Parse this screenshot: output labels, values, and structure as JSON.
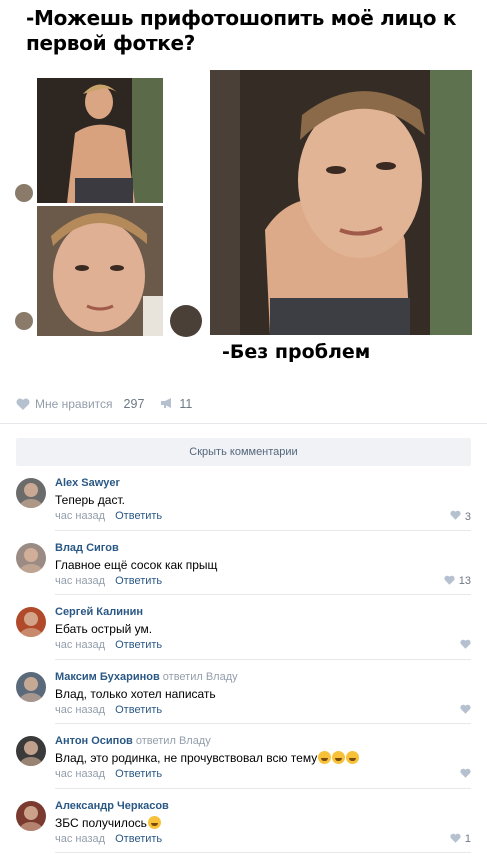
{
  "meme": {
    "caption": "-Можешь прифотошопить моё лицо к первой фотке?",
    "reply": "-Без проблем"
  },
  "post_stats": {
    "like_label": "Мне нравится",
    "like_count": "297",
    "share_count": "11"
  },
  "hide_comments_label": "Скрыть комментарии",
  "comments": [
    {
      "author": "Alex Sawyer",
      "reply_word": "",
      "reply_target": "",
      "text": "Теперь даст.",
      "time": "час назад",
      "reply_label": "Ответить",
      "likes": "3",
      "emojis": 0,
      "avatar_color": "#6b6b6b"
    },
    {
      "author": "Влад Сигов",
      "reply_word": "",
      "reply_target": "",
      "text": "Главное ещё сосок как прыщ",
      "time": "час назад",
      "reply_label": "Ответить",
      "likes": "13",
      "emojis": 0,
      "avatar_color": "#9a8c84"
    },
    {
      "author": "Сергей Калинин",
      "reply_word": "",
      "reply_target": "",
      "text": "Ебать острый ум.",
      "time": "час назад",
      "reply_label": "Ответить",
      "likes": "",
      "emojis": 0,
      "avatar_color": "#b04a2a"
    },
    {
      "author": "Максим Бухаринов",
      "reply_word": "ответил",
      "reply_target": "Владу",
      "text": "Влад, только хотел написать",
      "time": "час назад",
      "reply_label": "Ответить",
      "likes": "",
      "emojis": 0,
      "avatar_color": "#5a6a7a"
    },
    {
      "author": "Антон Осипов",
      "reply_word": "ответил",
      "reply_target": "Владу",
      "text": "Влад, это родинка, не прочувствовал всю тему",
      "time": "час назад",
      "reply_label": "Ответить",
      "likes": "",
      "emojis": 3,
      "avatar_color": "#3a3a3a"
    },
    {
      "author": "Александр Черкасов",
      "reply_word": "",
      "reply_target": "",
      "text": "ЗБС получилось",
      "time": "час назад",
      "reply_label": "Ответить",
      "likes": "1",
      "emojis": 1,
      "avatar_color": "#7a3a30"
    }
  ],
  "colors": {
    "link": "#2a5885",
    "muted": "#939eab",
    "divider": "#e7e8ec"
  }
}
